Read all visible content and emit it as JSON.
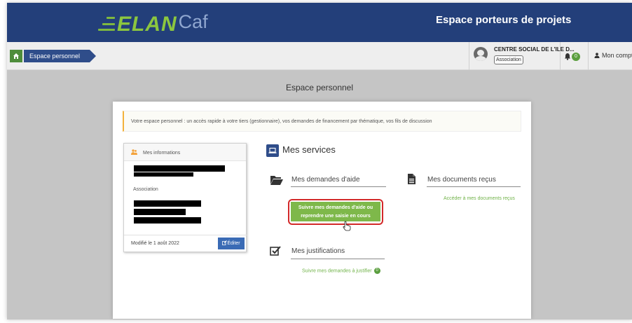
{
  "header": {
    "logo_main": "ELAN",
    "logo_suffix": "Caf",
    "title": "Espace porteurs de projets"
  },
  "breadcrumb": {
    "items": [
      {
        "label": "Espace personnel"
      }
    ]
  },
  "topbar": {
    "org_name": "CENTRE SOCIAL DE L'ILE D...",
    "org_type": "Association",
    "notification_count": "0",
    "account_label": "Mon compte"
  },
  "page": {
    "title": "Espace personnel",
    "intro": "Votre espace personnel : un accès rapide à votre tiers (gestionnaire), vos demandes de financement par thématique, vos fils de discussion"
  },
  "info_panel": {
    "title": "Mes informations",
    "org_type": "Association",
    "modified": "Modifié le 1 août 2022",
    "edit_label": "Éditer"
  },
  "services": {
    "title": "Mes services",
    "demandes": {
      "title": "Mes demandes d'aide",
      "button_line1": "Suivre mes demandes d'aide ou",
      "button_line2": "reprendre une saisie en cours"
    },
    "documents": {
      "title": "Mes documents reçus",
      "link": "Accéder à mes documents reçus"
    },
    "justifications": {
      "title": "Mes justifications",
      "link": "Suivre mes demandes à justifier",
      "count": "0"
    }
  },
  "colors": {
    "header_bg": "#233f7a",
    "accent_green": "#7eb84a",
    "highlight_red": "#d32a2a",
    "edit_blue": "#3a6bb5"
  },
  "icons": [
    "home-icon",
    "user-avatar-icon",
    "bell-icon",
    "user-icon",
    "users-icon",
    "laptop-icon",
    "folder-open-icon",
    "file-text-icon",
    "check-square-icon",
    "edit-icon",
    "hand-cursor-icon"
  ]
}
